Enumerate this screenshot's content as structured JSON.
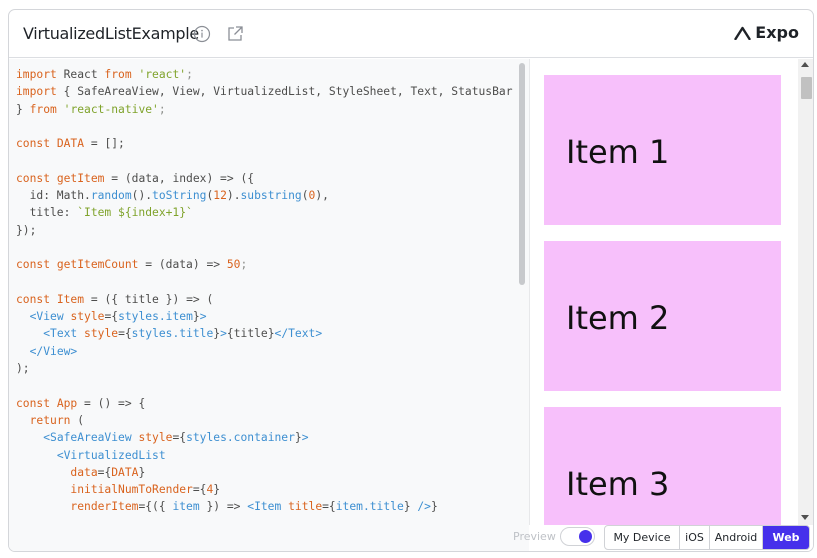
{
  "header": {
    "title": "VirtualizedListExample",
    "brand_label": "Expo"
  },
  "code_lines": [
    [
      [
        "kw",
        "import"
      ],
      [
        "pl",
        " React "
      ],
      [
        "kw",
        "from"
      ],
      [
        "pl",
        " "
      ],
      [
        "str",
        "'react'"
      ],
      [
        "pun",
        ";"
      ]
    ],
    [
      [
        "kw",
        "import"
      ],
      [
        "pl",
        " { SafeAreaView, View, VirtualizedList, StyleSheet, Text, StatusBar"
      ]
    ],
    [
      [
        "pl",
        "} "
      ],
      [
        "kw",
        "from"
      ],
      [
        "pl",
        " "
      ],
      [
        "str",
        "'react-native'"
      ],
      [
        "pun",
        ";"
      ]
    ],
    [],
    [
      [
        "kw",
        "const"
      ],
      [
        "pl",
        " "
      ],
      [
        "var",
        "DATA"
      ],
      [
        "pl",
        " = [];"
      ]
    ],
    [],
    [
      [
        "kw",
        "const"
      ],
      [
        "pl",
        " "
      ],
      [
        "var",
        "getItem"
      ],
      [
        "pl",
        " = (data, index) => ({"
      ]
    ],
    [
      [
        "pl",
        "  id: Math."
      ],
      [
        "fn",
        "random"
      ],
      [
        "pl",
        "()."
      ],
      [
        "fn",
        "toString"
      ],
      [
        "pl",
        "("
      ],
      [
        "num",
        "12"
      ],
      [
        "pl",
        ")."
      ],
      [
        "fn",
        "substring"
      ],
      [
        "pl",
        "("
      ],
      [
        "num",
        "0"
      ],
      [
        "pl",
        "),"
      ]
    ],
    [
      [
        "pl",
        "  title: "
      ],
      [
        "str",
        "`Item ${index+1}`"
      ]
    ],
    [
      [
        "pl",
        "});"
      ]
    ],
    [],
    [
      [
        "kw",
        "const"
      ],
      [
        "pl",
        " "
      ],
      [
        "var",
        "getItemCount"
      ],
      [
        "pl",
        " = (data) => "
      ],
      [
        "num",
        "50"
      ],
      [
        "pun",
        ";"
      ]
    ],
    [],
    [
      [
        "kw",
        "const"
      ],
      [
        "pl",
        " "
      ],
      [
        "var",
        "Item"
      ],
      [
        "pl",
        " = ({ title }) => ("
      ]
    ],
    [
      [
        "pl",
        "  "
      ],
      [
        "tag",
        "<View"
      ],
      [
        "pl",
        " "
      ],
      [
        "attr",
        "style"
      ],
      [
        "pl",
        "={"
      ],
      [
        "fn",
        "styles.item"
      ],
      [
        "pl",
        "}"
      ],
      [
        "tag",
        ">"
      ]
    ],
    [
      [
        "pl",
        "    "
      ],
      [
        "tag",
        "<Text"
      ],
      [
        "pl",
        " "
      ],
      [
        "attr",
        "style"
      ],
      [
        "pl",
        "={"
      ],
      [
        "fn",
        "styles.title"
      ],
      [
        "pl",
        "}"
      ],
      [
        "tag",
        ">"
      ],
      [
        "pl",
        "{title}"
      ],
      [
        "tag",
        "</Text>"
      ]
    ],
    [
      [
        "pl",
        "  "
      ],
      [
        "tag",
        "</View>"
      ]
    ],
    [
      [
        "pl",
        ");"
      ]
    ],
    [],
    [
      [
        "kw",
        "const"
      ],
      [
        "pl",
        " "
      ],
      [
        "var",
        "App"
      ],
      [
        "pl",
        " = () => {"
      ]
    ],
    [
      [
        "pl",
        "  "
      ],
      [
        "kw",
        "return"
      ],
      [
        "pl",
        " ("
      ]
    ],
    [
      [
        "pl",
        "    "
      ],
      [
        "tag",
        "<SafeAreaView"
      ],
      [
        "pl",
        " "
      ],
      [
        "attr",
        "style"
      ],
      [
        "pl",
        "={"
      ],
      [
        "fn",
        "styles.container"
      ],
      [
        "pl",
        "}"
      ],
      [
        "tag",
        ">"
      ]
    ],
    [
      [
        "pl",
        "      "
      ],
      [
        "tag",
        "<VirtualizedList"
      ]
    ],
    [
      [
        "pl",
        "        "
      ],
      [
        "attr",
        "data"
      ],
      [
        "pl",
        "={"
      ],
      [
        "var",
        "DATA"
      ],
      [
        "pl",
        "}"
      ]
    ],
    [
      [
        "pl",
        "        "
      ],
      [
        "attr",
        "initialNumToRender"
      ],
      [
        "pl",
        "={"
      ],
      [
        "num",
        "4"
      ],
      [
        "pl",
        "}"
      ]
    ],
    [
      [
        "pl",
        "        "
      ],
      [
        "attr",
        "renderItem"
      ],
      [
        "pl",
        "={({ "
      ],
      [
        "fn",
        "item"
      ],
      [
        "pl",
        " }) => "
      ],
      [
        "tag",
        "<Item"
      ],
      [
        "pl",
        " "
      ],
      [
        "attr",
        "title"
      ],
      [
        "pl",
        "={"
      ],
      [
        "fn",
        "item.title"
      ],
      [
        "pl",
        "} "
      ],
      [
        "tag",
        "/>"
      ],
      [
        "pl",
        "}"
      ]
    ]
  ],
  "preview": {
    "items": [
      "Item 1",
      "Item 2",
      "Item 3"
    ],
    "item_color": "#f7c0fb"
  },
  "footer": {
    "preview_label": "Preview",
    "preview_enabled": true,
    "platforms": [
      {
        "label": "My Device",
        "active": false
      },
      {
        "label": "iOS",
        "active": false
      },
      {
        "label": "Android",
        "active": false
      },
      {
        "label": "Web",
        "active": true
      }
    ]
  },
  "colors": {
    "accent": "#4630eb"
  }
}
